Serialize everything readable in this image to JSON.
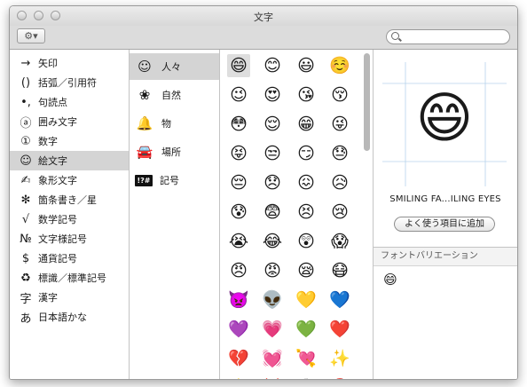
{
  "window": {
    "title": "文字"
  },
  "toolbar": {
    "gear_label": "⚙▾",
    "search_placeholder": "",
    "search_value": ""
  },
  "categories": [
    {
      "symbol": "→",
      "label": "矢印"
    },
    {
      "symbol": "()",
      "label": "括弧／引用符"
    },
    {
      "symbol": "•,",
      "label": "句読点"
    },
    {
      "symbol": "ⓐ",
      "label": "囲み文字"
    },
    {
      "symbol": "①",
      "label": "数字"
    },
    {
      "symbol": "☺",
      "label": "絵文字",
      "selected": true
    },
    {
      "symbol": "✍",
      "label": "象形文字"
    },
    {
      "symbol": "✻",
      "label": "箇条書き／星"
    },
    {
      "symbol": "√",
      "label": "数学記号"
    },
    {
      "symbol": "№",
      "label": "文字様記号"
    },
    {
      "symbol": "$",
      "label": "通貨記号"
    },
    {
      "symbol": "♻",
      "label": "標識／標準記号"
    },
    {
      "symbol": "字",
      "label": "漢字"
    },
    {
      "symbol": "あ",
      "label": "日本語かな"
    }
  ],
  "subcategories": [
    {
      "symbol": "☺",
      "label": "人々",
      "selected": true
    },
    {
      "symbol": "❀",
      "label": "自然"
    },
    {
      "symbol": "🔔",
      "label": "物"
    },
    {
      "symbol": "🚘",
      "label": "場所"
    },
    {
      "symbol": "!?#",
      "label": "記号",
      "boxed": true
    }
  ],
  "emojis": [
    [
      "😄",
      "😊",
      "😃",
      "☺️"
    ],
    [
      "😉",
      "😍",
      "😘",
      "😚"
    ],
    [
      "😳",
      "😌",
      "😁",
      "😜"
    ],
    [
      "😝",
      "😒",
      "😏",
      "😓"
    ],
    [
      "😔",
      "😞",
      "😖",
      "😥"
    ],
    [
      "😰",
      "😨",
      "😣",
      "😢"
    ],
    [
      "😭",
      "😂",
      "😲",
      "😱"
    ],
    [
      "😠",
      "😡",
      "😪",
      "😷"
    ],
    [
      "👿",
      "👽",
      "💛",
      "💙"
    ],
    [
      "💜",
      "💗",
      "💚",
      "❤️"
    ],
    [
      "💔",
      "💓",
      "💘",
      "✨"
    ],
    [
      "⭐",
      "💢",
      "❕",
      "❓"
    ]
  ],
  "selected_emoji": {
    "glyph": "😄",
    "name": "SMILING FA...ILING EYES"
  },
  "preview": {
    "add_favorite_label": "よく使う項目に追加"
  },
  "variations": {
    "header": "フォントバリエーション",
    "items": [
      "😄"
    ]
  }
}
